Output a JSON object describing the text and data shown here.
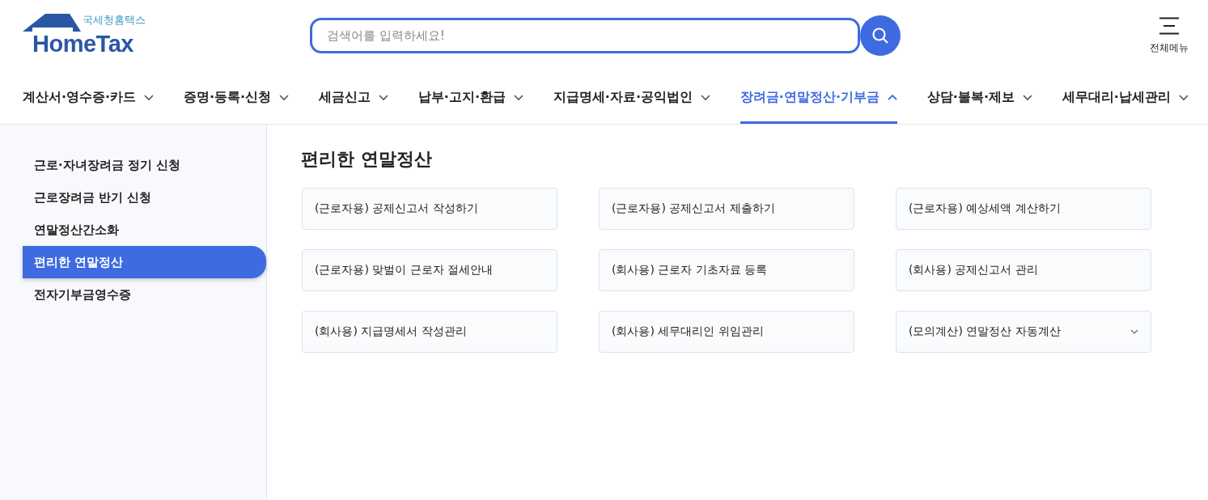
{
  "logo": {
    "subtitle": "국세청홈택스",
    "title": "HomeTax"
  },
  "search": {
    "placeholder": "검색어를 입력하세요!"
  },
  "all_menu": {
    "label": "전체메뉴"
  },
  "nav": [
    {
      "label": "계산서·영수증·카드",
      "selected": false
    },
    {
      "label": "증명·등록·신청",
      "selected": false
    },
    {
      "label": "세금신고",
      "selected": false
    },
    {
      "label": "납부·고지·환급",
      "selected": false
    },
    {
      "label": "지급명세·자료·공익법인",
      "selected": false
    },
    {
      "label": "장려금·연말정산·기부금",
      "selected": true
    },
    {
      "label": "상담·불복·제보",
      "selected": false
    },
    {
      "label": "세무대리·납세관리",
      "selected": false
    }
  ],
  "sidebar": {
    "items": [
      {
        "label": "근로·자녀장려금 정기 신청",
        "selected": false
      },
      {
        "label": "근로장려금 반기 신청",
        "selected": false
      },
      {
        "label": "연말정산간소화",
        "selected": false
      },
      {
        "label": "편리한 연말정산",
        "selected": true
      },
      {
        "label": "전자기부금영수증",
        "selected": false
      }
    ]
  },
  "content": {
    "title": "편리한 연말정산",
    "cards": [
      {
        "label": "(근로자용) 공제신고서 작성하기",
        "kind": "link"
      },
      {
        "label": "(근로자용) 공제신고서 제출하기",
        "kind": "link"
      },
      {
        "label": "(근로자용) 예상세액 계산하기",
        "kind": "link"
      },
      {
        "label": "(근로자용) 맞벌이 근로자 절세안내",
        "kind": "link"
      },
      {
        "label": "(회사용) 근로자 기초자료 등록",
        "kind": "link"
      },
      {
        "label": "(회사용) 공제신고서 관리",
        "kind": "link"
      },
      {
        "label": "(회사용) 지급명세서 작성관리",
        "kind": "link"
      },
      {
        "label": "(회사용) 세무대리인 위임관리",
        "kind": "link"
      },
      {
        "label": "(모의계산) 연말정산 자동계산",
        "kind": "dropdown"
      }
    ]
  }
}
